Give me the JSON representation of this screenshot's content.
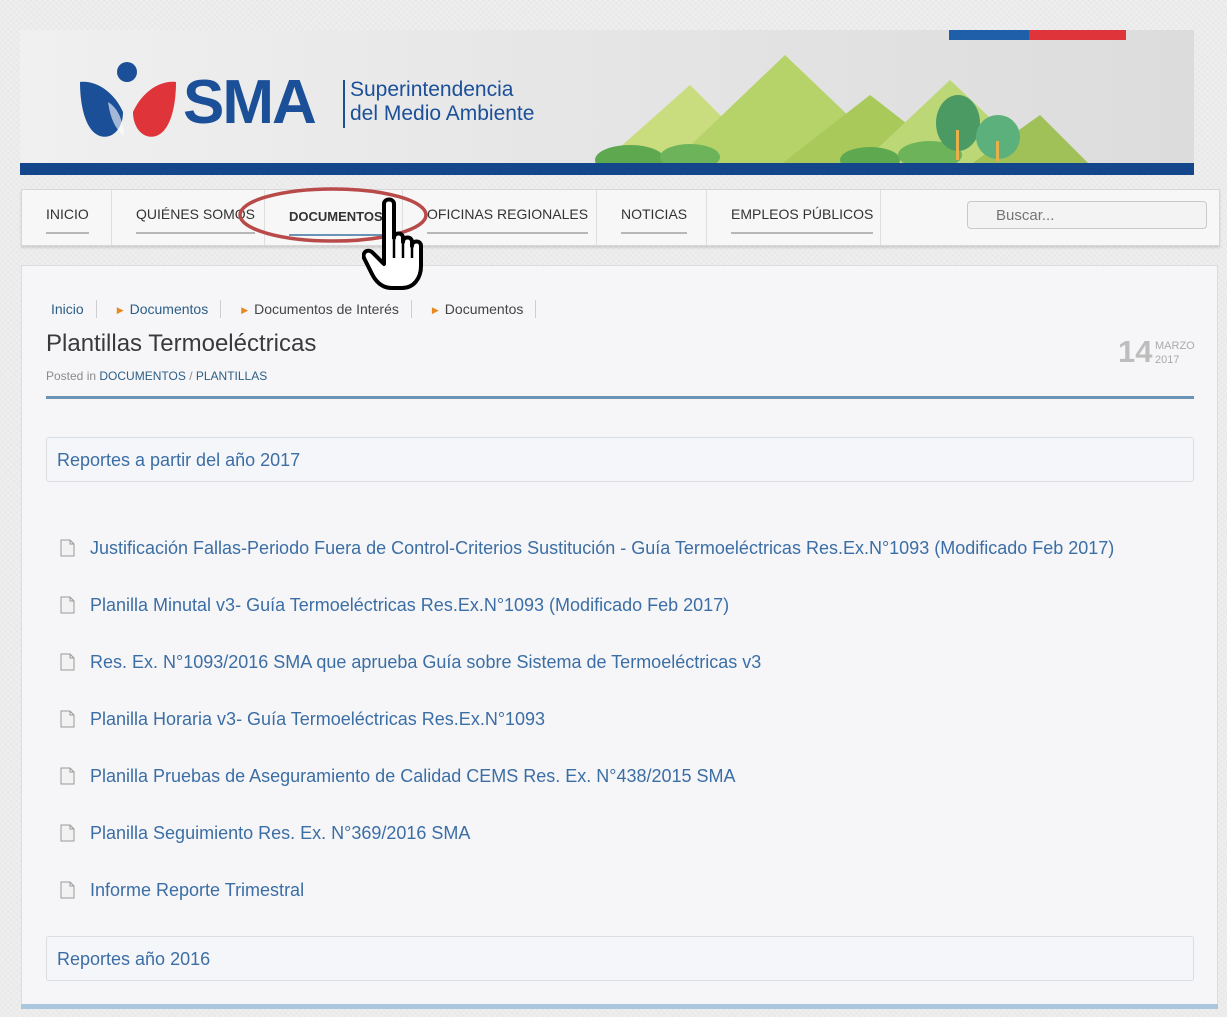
{
  "header": {
    "logo_text": "SMA",
    "logo_sub_line1": "Superintendencia",
    "logo_sub_line2": "del Medio Ambiente"
  },
  "nav": {
    "items": [
      {
        "label": "INICIO"
      },
      {
        "label": "QUIÉNES SOMOS"
      },
      {
        "label": "DOCUMENTOS",
        "active": true
      },
      {
        "label": "OFICINAS REGIONALES"
      },
      {
        "label": "NOTICIAS"
      },
      {
        "label": "EMPLEOS PÚBLICOS"
      }
    ],
    "search_placeholder": "Buscar..."
  },
  "breadcrumb": {
    "items": [
      "Inicio",
      "Documentos",
      "Documentos de Interés",
      "Documentos"
    ]
  },
  "post": {
    "title": "Plantillas Termoeléctricas",
    "posted_prefix": "Posted in",
    "category1": "DOCUMENTOS",
    "separator": "/",
    "category2": "PLANTILLAS",
    "date_day": "14",
    "date_month": "MARZO",
    "date_year": "2017"
  },
  "sections": [
    {
      "title": "Reportes a partir del año 2017"
    },
    {
      "title": "Reportes año 2016"
    }
  ],
  "documents": [
    "Justificación Fallas-Periodo Fuera de Control-Criterios Sustitución - Guía Termoeléctricas Res.Ex.N°1093 (Modificado Feb 2017)",
    "Planilla Minutal v3- Guía Termoeléctricas Res.Ex.N°1093 (Modificado Feb 2017)",
    "Res. Ex. N°1093/2016 SMA que aprueba Guía sobre Sistema de Termoeléctricas v3",
    "Planilla Horaria v3- Guía Termoeléctricas Res.Ex.N°1093",
    "Planilla Pruebas de Aseguramiento de Calidad CEMS Res. Ex. N°438/2015 SMA",
    "Planilla Seguimiento Res. Ex. N°369/2016 SMA",
    "Informe Reporte Trimestral"
  ],
  "colors": {
    "brand_blue": "#1b4f98",
    "link_blue": "#3b6ea5",
    "accent_red": "#e0343b",
    "highlight_red": "#b94a4a"
  },
  "icons": [
    "search-icon",
    "document-icon",
    "hand-pointer-cursor-icon",
    "breadcrumb-arrow-icon"
  ]
}
